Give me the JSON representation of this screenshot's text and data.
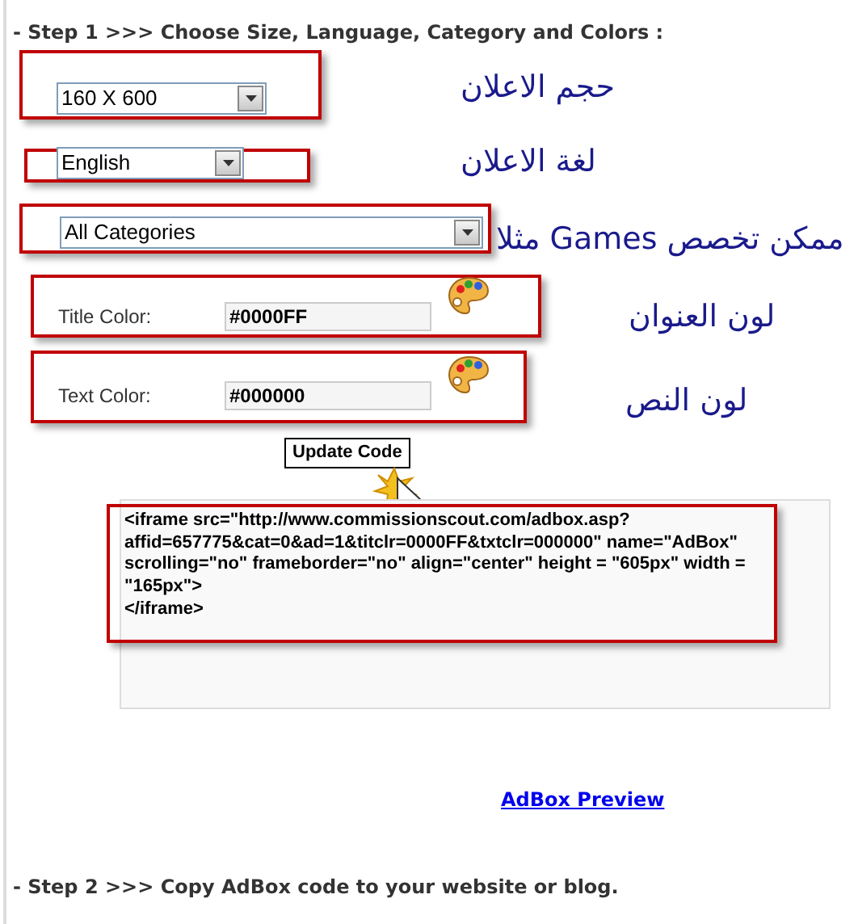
{
  "step1": "- Step 1 >>> Choose Size, Language, Category and Colors :",
  "dropdowns": [
    {
      "value": "160 X 600",
      "note": "حجم الاعلان"
    },
    {
      "value": "English",
      "note": "لغة الاعلان"
    },
    {
      "value": "All Categories",
      "note": "ممكن تخصص Games مثلا"
    }
  ],
  "color_fields": [
    {
      "label": "Title Color:",
      "value": "#0000FF",
      "note": "لون العنوان"
    },
    {
      "label": "Text Color:",
      "value": "#000000",
      "note": "لون النص"
    }
  ],
  "update_button": "Update Code",
  "code_lines": [
    "<iframe src=\"http://www.commissionscout.com/adbox.asp?",
    "affid=657775&cat=0&ad=1&titclr=0000FF&txtclr=000000\" name=\"AdBox\"",
    "scrolling=\"no\" frameborder=\"no\" align=\"center\" height = \"605px\" width =",
    "\"165px\">",
    "</iframe>"
  ],
  "preview_link": "AdBox Preview",
  "step2": "- Step 2  >>> Copy AdBox code to your website or blog."
}
